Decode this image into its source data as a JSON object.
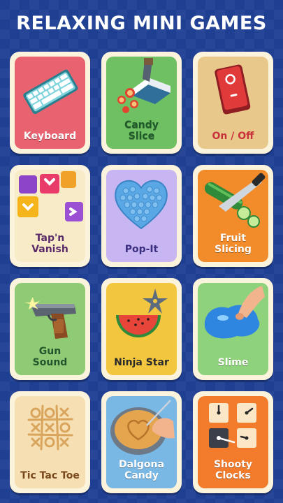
{
  "header": {
    "title": "RELAXING MINI GAMES"
  },
  "games": [
    {
      "label": "Keyboard",
      "icon": "keyboard-icon",
      "bg": "#e8636f",
      "text_color": "#ffffff"
    },
    {
      "label": "Candy\nSlice",
      "icon": "candy-slice-icon",
      "bg": "#6fbf63",
      "text_color": "#1f5b2a"
    },
    {
      "label": "On / Off",
      "icon": "switch-icon",
      "bg": "#e9c88c",
      "text_color": "#c8323a"
    },
    {
      "label": "Tap'n\nVanish",
      "icon": "blocks-icon",
      "bg": "#f8ecc8",
      "text_color": "#5a2a6a"
    },
    {
      "label": "Pop-It",
      "icon": "pop-it-icon",
      "bg": "#c7b6f2",
      "text_color": "#3b2f80"
    },
    {
      "label": "Fruit\nSlicing",
      "icon": "cucumber-knife-icon",
      "bg": "#f28b2a",
      "text_color": "#ffffff"
    },
    {
      "label": "Gun\nSound",
      "icon": "pistol-icon",
      "bg": "#8fcb74",
      "text_color": "#24552c"
    },
    {
      "label": "Ninja Star",
      "icon": "ninja-star-icon",
      "bg": "#f3c63f",
      "text_color": "#2a2a2a"
    },
    {
      "label": "Slime",
      "icon": "slime-icon",
      "bg": "#8ed27b",
      "text_color": "#ffffff"
    },
    {
      "label": "Tic Tac Toe",
      "icon": "tic-tac-toe-icon",
      "bg": "#f6e0b3",
      "text_color": "#7a4a1e"
    },
    {
      "label": "Dalgona\nCandy",
      "icon": "dalgona-icon",
      "bg": "#79b7e5",
      "text_color": "#ffffff"
    },
    {
      "label": "Shooty\nClocks",
      "icon": "clocks-icon",
      "bg": "#f27c2b",
      "text_color": "#ffffff"
    }
  ]
}
